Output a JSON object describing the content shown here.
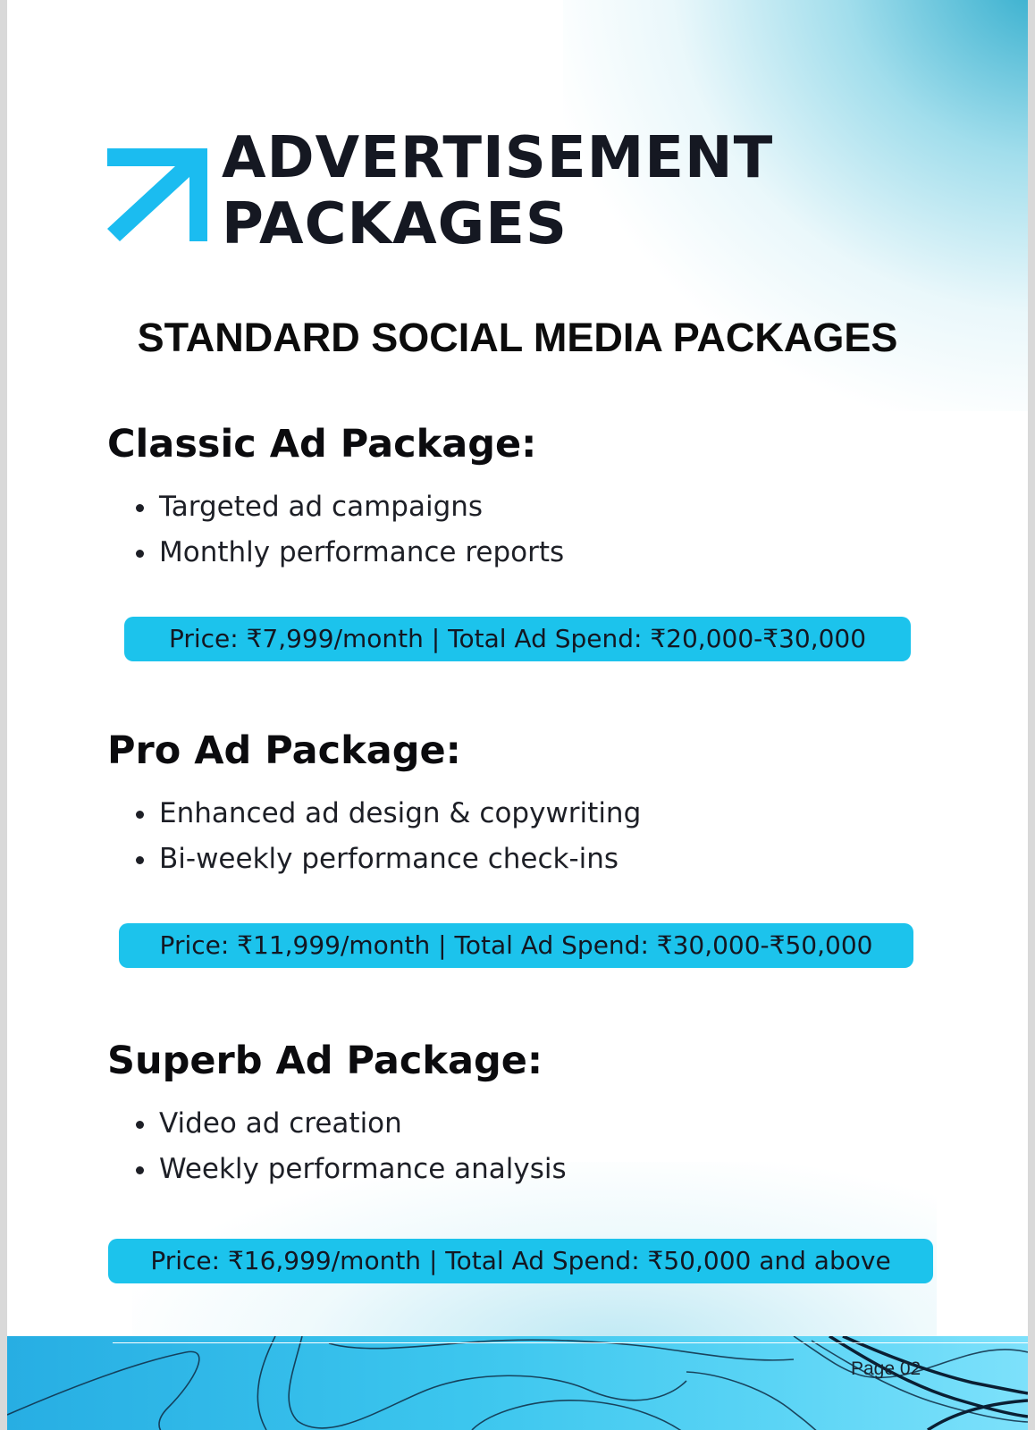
{
  "header": {
    "title_line1": "ADVERTISEMENT",
    "title_line2": "PACKAGES",
    "logo_icon": "arrow-up-right-icon",
    "accent_color": "#1bbcf0"
  },
  "subtitle": "STANDARD SOCIAL MEDIA PACKAGES",
  "packages": [
    {
      "title": "Classic Ad Package:",
      "features": [
        "Targeted ad campaigns",
        "Monthly performance reports"
      ],
      "price": "Price: ₹7,999/month | Total Ad Spend: ₹20,000-₹30,000"
    },
    {
      "title": "Pro Ad Package:",
      "features": [
        "Enhanced ad design & copywriting",
        "Bi-weekly performance check-ins"
      ],
      "price": "Price: ₹11,999/month | Total Ad Spend: ₹30,000-₹50,000"
    },
    {
      "title": "Superb Ad Package:",
      "features": [
        "Video ad creation",
        "Weekly performance analysis"
      ],
      "price": "Price: ₹16,999/month | Total Ad Spend: ₹50,000 and above"
    }
  ],
  "footer": {
    "page_number": "Page 02"
  },
  "colors": {
    "price_bar": "#1cc3ec",
    "heading_text": "#151822",
    "footer_start": "#27aee3",
    "footer_end": "#7de1fb"
  }
}
